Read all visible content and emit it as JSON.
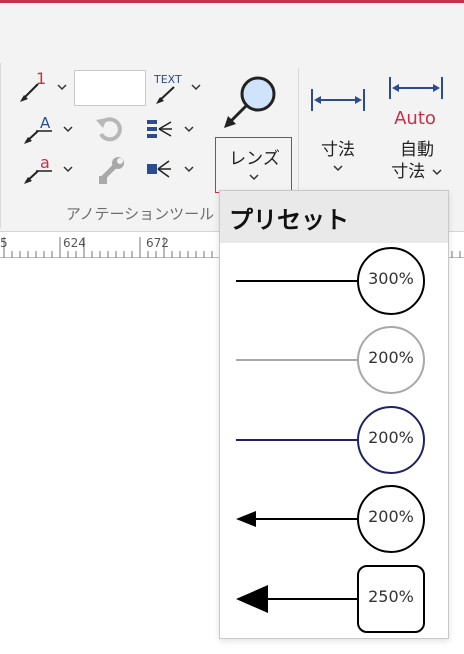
{
  "ribbon": {
    "lens_label": "レンズ",
    "dimension_label": "寸法",
    "auto_dimension_label_line1": "自動",
    "auto_dimension_label_line2": "寸法",
    "auto_badge": "Auto",
    "leader_number_badge": "1",
    "leader_letter_badge": "A",
    "leader_small_letter_badge": "a",
    "text_leader_badge": "TEXT",
    "group_label": "アノテーションツール",
    "text_box_value": ""
  },
  "ruler": {
    "labels": [
      "5",
      "624",
      "672"
    ]
  },
  "dropdown": {
    "title": "プリセット",
    "presets": [
      {
        "label": "300%",
        "line_color": "#000000",
        "circle_color": "#000000",
        "shape": "circle",
        "arrow": "none"
      },
      {
        "label": "200%",
        "line_color": "#a8a8a8",
        "circle_color": "#a8a8a8",
        "shape": "circle",
        "arrow": "none"
      },
      {
        "label": "200%",
        "line_color": "#1f2366",
        "circle_color": "#1f2366",
        "shape": "circle",
        "arrow": "none"
      },
      {
        "label": "200%",
        "line_color": "#000000",
        "circle_color": "#000000",
        "shape": "circle",
        "arrow": "small"
      },
      {
        "label": "250%",
        "line_color": "#000000",
        "circle_color": "#000000",
        "shape": "rounded-square",
        "arrow": "large"
      }
    ]
  },
  "colors": {
    "accent_red": "#c4314b",
    "icon_blue": "#2d4c8f"
  }
}
